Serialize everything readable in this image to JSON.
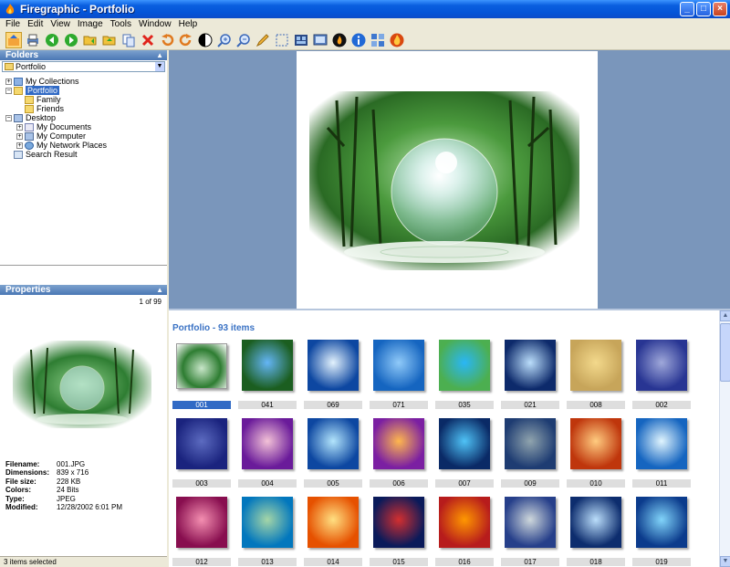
{
  "window": {
    "title": "Firegraphic - Portfolio",
    "minimize": "_",
    "maximize": "□",
    "close": "×"
  },
  "menu": [
    "File",
    "Edit",
    "View",
    "Image",
    "Tools",
    "Window",
    "Help"
  ],
  "toolbar": {
    "icons": [
      "browse-mode-icon",
      "print-icon",
      "back-icon",
      "forward-icon",
      "open-folder-icon",
      "move-to-folder-icon",
      "copy-icon",
      "delete-icon",
      "rotate-left-icon",
      "rotate-right-icon",
      "contrast-icon",
      "zoom-in-icon",
      "zoom-out-icon",
      "edit-pencil-icon",
      "select-icon",
      "film-strip-icon",
      "slideshow-icon",
      "fire-icon",
      "info-icon",
      "layout-icon",
      "firegraphic-icon"
    ]
  },
  "folders_panel": {
    "header": "Folders",
    "combo_value": "Portfolio",
    "tree": [
      {
        "label": "My Collections",
        "level": 0,
        "toggle": "+",
        "icon": "blue"
      },
      {
        "label": "Portfolio",
        "level": 0,
        "toggle": "−",
        "icon": "folder",
        "selected": true
      },
      {
        "label": "Family",
        "level": 1,
        "toggle": "",
        "icon": "folder"
      },
      {
        "label": "Friends",
        "level": 1,
        "toggle": "",
        "icon": "folder"
      },
      {
        "label": "Desktop",
        "level": 0,
        "toggle": "−",
        "icon": "comp"
      },
      {
        "label": "My Documents",
        "level": 1,
        "toggle": "+",
        "icon": "doc"
      },
      {
        "label": "My Computer",
        "level": 1,
        "toggle": "+",
        "icon": "comp"
      },
      {
        "label": "My Network Places",
        "level": 1,
        "toggle": "+",
        "icon": "net"
      },
      {
        "label": "Search Result",
        "level": 0,
        "toggle": "",
        "icon": "search"
      }
    ]
  },
  "properties_panel": {
    "header": "Properties",
    "count": "1 of 99",
    "rows": [
      {
        "key": "Filename:",
        "value": "001.JPG"
      },
      {
        "key": "Dimensions:",
        "value": "839 x 716"
      },
      {
        "key": "File size:",
        "value": "228 KB"
      },
      {
        "key": "Colors:",
        "value": "24 Bits"
      },
      {
        "key": "Type:",
        "value": "JPEG"
      },
      {
        "key": "Modified:",
        "value": "12/28/2002 6:01 PM"
      }
    ]
  },
  "status": "3 items selected",
  "gallery": {
    "title": "Portfolio - 93 items",
    "items": [
      {
        "name": "001",
        "color1": "#2e7d32",
        "color2": "#c8e6c9",
        "selected": true
      },
      {
        "name": "041",
        "color1": "#1b5e20",
        "color2": "#64b5f6"
      },
      {
        "name": "069",
        "color1": "#0d47a1",
        "color2": "#e3f2fd"
      },
      {
        "name": "071",
        "color1": "#1565c0",
        "color2": "#90caf9"
      },
      {
        "name": "035",
        "color1": "#4caf50",
        "color2": "#29b6f6"
      },
      {
        "name": "021",
        "color1": "#0d2a6b",
        "color2": "#bbdefb"
      },
      {
        "name": "008",
        "color1": "#c7a55a",
        "color2": "#f3d98c"
      },
      {
        "name": "002",
        "color1": "#283593",
        "color2": "#9fa8da"
      },
      {
        "name": "003",
        "color1": "#1a237e",
        "color2": "#5c6bc0"
      },
      {
        "name": "004",
        "color1": "#6a1b9a",
        "color2": "#f3c2d7"
      },
      {
        "name": "005",
        "color1": "#0d47a1",
        "color2": "#b3e5fc"
      },
      {
        "name": "006",
        "color1": "#7b1fa2",
        "color2": "#ffb74d"
      },
      {
        "name": "007",
        "color1": "#0a2a66",
        "color2": "#4fc3f7"
      },
      {
        "name": "009",
        "color1": "#1e3c72",
        "color2": "#90a4ae"
      },
      {
        "name": "010",
        "color1": "#bf360c",
        "color2": "#ffcc80"
      },
      {
        "name": "011",
        "color1": "#1565c0",
        "color2": "#e1f5fe"
      },
      {
        "name": "012",
        "color1": "#880e4f",
        "color2": "#f48fb1"
      },
      {
        "name": "013",
        "color1": "#0277bd",
        "color2": "#a5d6a7"
      },
      {
        "name": "014",
        "color1": "#e65100",
        "color2": "#ffe082"
      },
      {
        "name": "015",
        "color1": "#0a1a5a",
        "color2": "#d32f2f"
      },
      {
        "name": "016",
        "color1": "#b71c1c",
        "color2": "#ff9800"
      },
      {
        "name": "017",
        "color1": "#263f8a",
        "color2": "#cfd8dc"
      },
      {
        "name": "018",
        "color1": "#0d2d6e",
        "color2": "#bbdefb"
      },
      {
        "name": "019",
        "color1": "#0b3b8c",
        "color2": "#81d4fa"
      }
    ]
  },
  "colors": {
    "accent": "#316ac5",
    "title_bar": "#0454d8",
    "preview_bg": "#7a96bb",
    "gallery_title": "#3a72c4"
  }
}
